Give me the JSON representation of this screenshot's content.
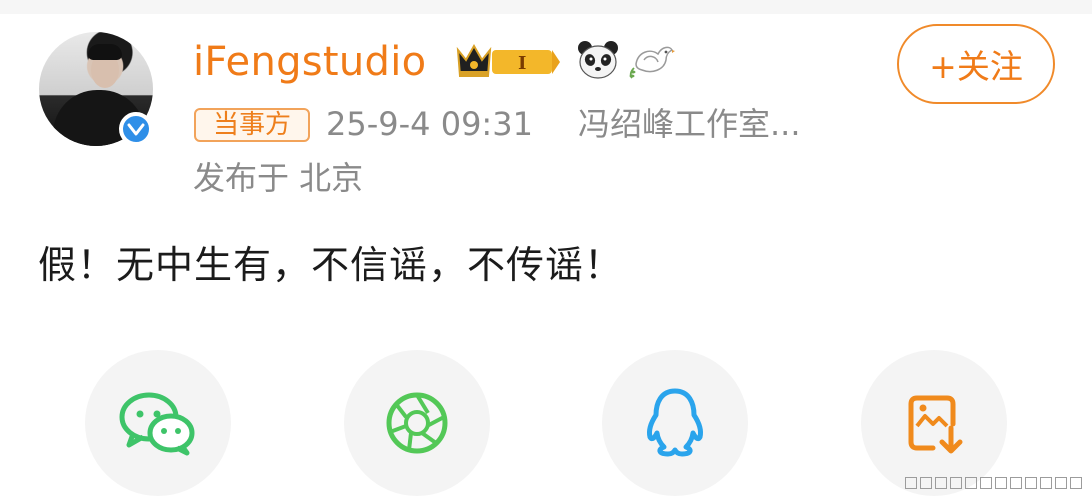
{
  "post": {
    "username": "iFengstudio",
    "follow_label": "+关注",
    "party_tag": "当事方",
    "timestamp": "25-9-4 09:31",
    "source": "冯绍峰工作室...",
    "location": "发布于 北京",
    "content": "假！无中生有，不信谣，不传谣！"
  },
  "badges": {
    "crown_level": "I",
    "icons": [
      "crown-badge-icon",
      "panda-icon",
      "dove-icon"
    ]
  },
  "share": [
    {
      "name": "wechat",
      "icon": "wechat-icon"
    },
    {
      "name": "moments",
      "icon": "moments-icon"
    },
    {
      "name": "qq",
      "icon": "qq-icon"
    },
    {
      "name": "save-image",
      "icon": "save-image-icon"
    }
  ],
  "colors": {
    "accent": "#f07b18",
    "meta_text": "#8a8a8a",
    "verified": "#2f8fe8",
    "wechat": "#3ec469",
    "moments": "#53c857",
    "qq": "#2aa4ec",
    "save": "#f08a1c"
  }
}
